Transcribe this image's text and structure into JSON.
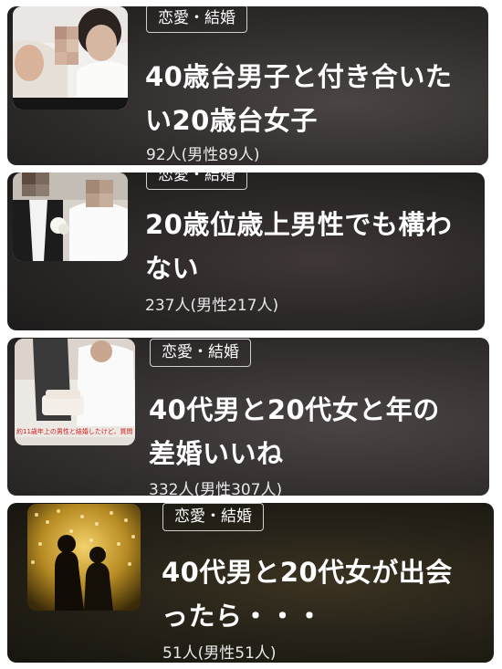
{
  "items": [
    {
      "category": "恋愛・結婚",
      "title": "40歳台男子と付き合いたい20歳台女子",
      "count": "92人(男性89人)"
    },
    {
      "category": "恋愛・結婚",
      "title": "20歳位歳上男性でも構わない",
      "count": "237人(男性217人)"
    },
    {
      "category": "恋愛・結婚",
      "title": "40代男と20代女と年の差婚いいね",
      "count": "332人(男性307人)",
      "thumb_caption": "約11歳年上の男性と結婚したけど、質問"
    },
    {
      "category": "恋愛・結婚",
      "title": "40代男と20代女が出会ったら・・・",
      "count": "51人(男性51人)"
    }
  ],
  "colors": {
    "text": "#ffffff",
    "tag_border": "#cfcfcf",
    "thumb_caption": "#d32020"
  }
}
